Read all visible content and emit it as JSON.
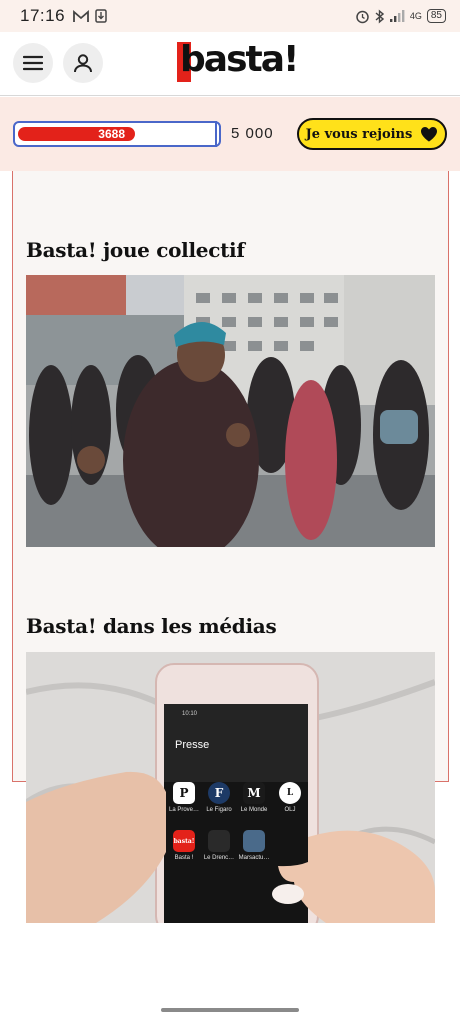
{
  "status_bar": {
    "time": "17:16",
    "left_icons": [
      "gmail-icon",
      "download-icon"
    ],
    "right_icons": [
      "alarm-icon",
      "bluetooth-icon",
      "signal-icon"
    ],
    "network": "4G",
    "battery": "85"
  },
  "header": {
    "menu_icon": "hamburger-menu-icon",
    "account_icon": "user-icon",
    "logo_text": "basta!"
  },
  "goal": {
    "current_label": "3688",
    "target_label": "5 000",
    "progress_fraction": 0.7376,
    "join_button_label": "Je vous rejoins",
    "join_icon": "heart-icon"
  },
  "sections": [
    {
      "title": "Basta! joue collectif"
    },
    {
      "title": "Basta! dans les médias"
    }
  ],
  "phone_mockup": {
    "clock": "10:10",
    "folder_title": "Presse",
    "apps": [
      {
        "label": "La Prove…",
        "glyph": "P"
      },
      {
        "label": "Le Figaro",
        "glyph": "F"
      },
      {
        "label": "Le Monde",
        "glyph": "M"
      },
      {
        "label": "OLJ",
        "glyph": "L"
      },
      {
        "label": "Basta !",
        "glyph": "basta!"
      },
      {
        "label": "Le Drenc…",
        "glyph": ""
      },
      {
        "label": "Marsactu…",
        "glyph": ""
      }
    ]
  },
  "colors": {
    "brand_red": "#e3221a",
    "join_yellow": "#ffe11a",
    "banner_bg": "#fbeae4",
    "progress_border": "#4a67c9"
  }
}
